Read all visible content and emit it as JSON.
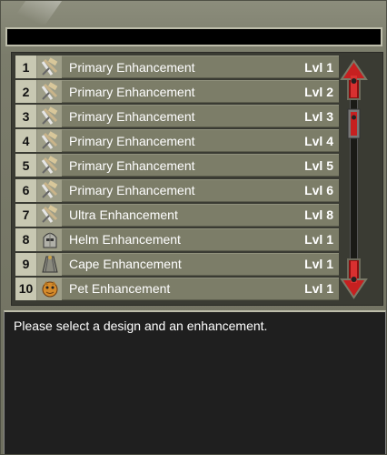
{
  "rows": [
    {
      "num": "1",
      "icon": "crossed-tools-icon",
      "name": "Primary Enhancement",
      "level": "Lvl 1"
    },
    {
      "num": "2",
      "icon": "crossed-tools-icon",
      "name": "Primary Enhancement",
      "level": "Lvl 2"
    },
    {
      "num": "3",
      "icon": "crossed-tools-icon",
      "name": "Primary Enhancement",
      "level": "Lvl 3"
    },
    {
      "num": "4",
      "icon": "crossed-tools-icon",
      "name": "Primary Enhancement",
      "level": "Lvl 4"
    },
    {
      "num": "5",
      "icon": "crossed-tools-icon",
      "name": "Primary Enhancement",
      "level": "Lvl 5"
    },
    {
      "num": "6",
      "icon": "crossed-tools-icon",
      "name": "Primary Enhancement",
      "level": "Lvl 6"
    },
    {
      "num": "7",
      "icon": "crossed-tools-icon",
      "name": "Ultra Enhancement",
      "level": "Lvl 8"
    },
    {
      "num": "8",
      "icon": "helm-icon",
      "name": "Helm Enhancement",
      "level": "Lvl 1"
    },
    {
      "num": "9",
      "icon": "cape-icon",
      "name": "Cape Enhancement",
      "level": "Lvl 1"
    },
    {
      "num": "10",
      "icon": "pet-icon",
      "name": "Pet Enhancement",
      "level": "Lvl 1"
    }
  ],
  "description": {
    "text": "Please select a design and an enhancement."
  },
  "colors": {
    "frame": "#7b7c6b",
    "row_bg": "#7c7d68",
    "number_bg": "#c8c8b2",
    "arrow_red": "#c62020",
    "panel_dark": "#1f1f1f"
  },
  "scrollbar": {
    "up_icon": "arrow-up-icon",
    "down_icon": "arrow-down-icon",
    "position": 0
  }
}
